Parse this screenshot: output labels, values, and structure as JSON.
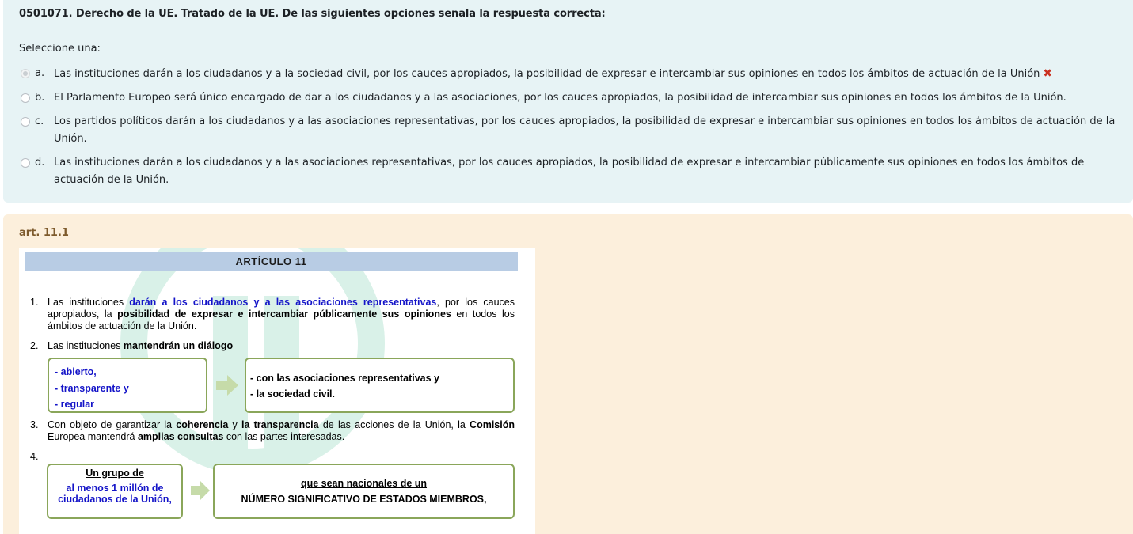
{
  "question": {
    "text": "0501071. Derecho de la UE. Tratado de la UE. De las siguientes opciones señala la respuesta correcta:",
    "prompt": "Seleccione una:",
    "options": [
      {
        "letter": "a.",
        "text": "Las instituciones darán a los ciudadanos y a la sociedad civil, por los cauces apropiados, la posibilidad de expresar e intercambiar sus opiniones en todos los ámbitos de actuación de la Unión",
        "selected": true,
        "wrong_mark": "✖"
      },
      {
        "letter": "b.",
        "text": "El Parlamento Europeo será único encargado de dar a los ciudadanos y a las asociaciones, por los cauces apropiados, la posibilidad de intercambiar sus opiniones en todos los ámbitos de la Unión.",
        "selected": false
      },
      {
        "letter": "c.",
        "text": "Los partidos políticos darán a los ciudadanos y a las asociaciones representativas, por los cauces apropiados, la posibilidad de expresar e intercambiar sus opiniones en todos los ámbitos de actuación de la Unión.",
        "selected": false
      },
      {
        "letter": "d.",
        "text": "Las instituciones darán a los ciudadanos y a las asociaciones representativas, por los cauces apropiados, la posibilidad de expresar e intercambiar públicamente sus opiniones en todos los ámbitos de actuación de la Unión.",
        "selected": false
      }
    ]
  },
  "feedback": {
    "reference": "art. 11.1",
    "article": {
      "heading": "ARTÍCULO 11",
      "p1": {
        "num": "1.",
        "t1": "Las instituciones ",
        "t2": "darán a los ciudadanos y a las asociaciones representativas",
        "t3": ", por los cauces apropiados, la ",
        "t4": "posibilidad de expresar e intercambiar públicamente sus opiniones",
        "t5": " en todos los ámbitos de actuación de la Unión."
      },
      "p2": {
        "num": "2.",
        "t1": "Las instituciones ",
        "t2": "mantendrán un diálogo",
        "left_lines": [
          "- abierto,",
          "- transparente y",
          "- regular"
        ],
        "right_lines": [
          "- con las asociaciones representativas y",
          "- la sociedad civil."
        ]
      },
      "p3": {
        "num": "3.",
        "t1": "Con objeto de garantizar la ",
        "t2": "coherencia",
        "t3": " y ",
        "t4": "la transparencia",
        "t5": " de las acciones de la Unión, la ",
        "t6": "Comisión",
        "t7": " Europea mantendrá ",
        "t8": "amplias consultas",
        "t9": " con las partes interesadas."
      },
      "p4": {
        "num": "4.",
        "left_title": "Un grupo de",
        "left_body": "al menos 1 millón de ciudadanos de la Unión,",
        "right_title": "que sean nacionales de un",
        "right_body": "NÚMERO SIGNIFICATIVO DE ESTADOS MIEMBROS,"
      }
    }
  },
  "colors": {
    "wrong": "#ca3120",
    "feedback_bg": "#fcefdc",
    "question_bg": "#e7f3f5",
    "box_border": "#8aa65a",
    "highlight_blue": "#1414c8"
  }
}
